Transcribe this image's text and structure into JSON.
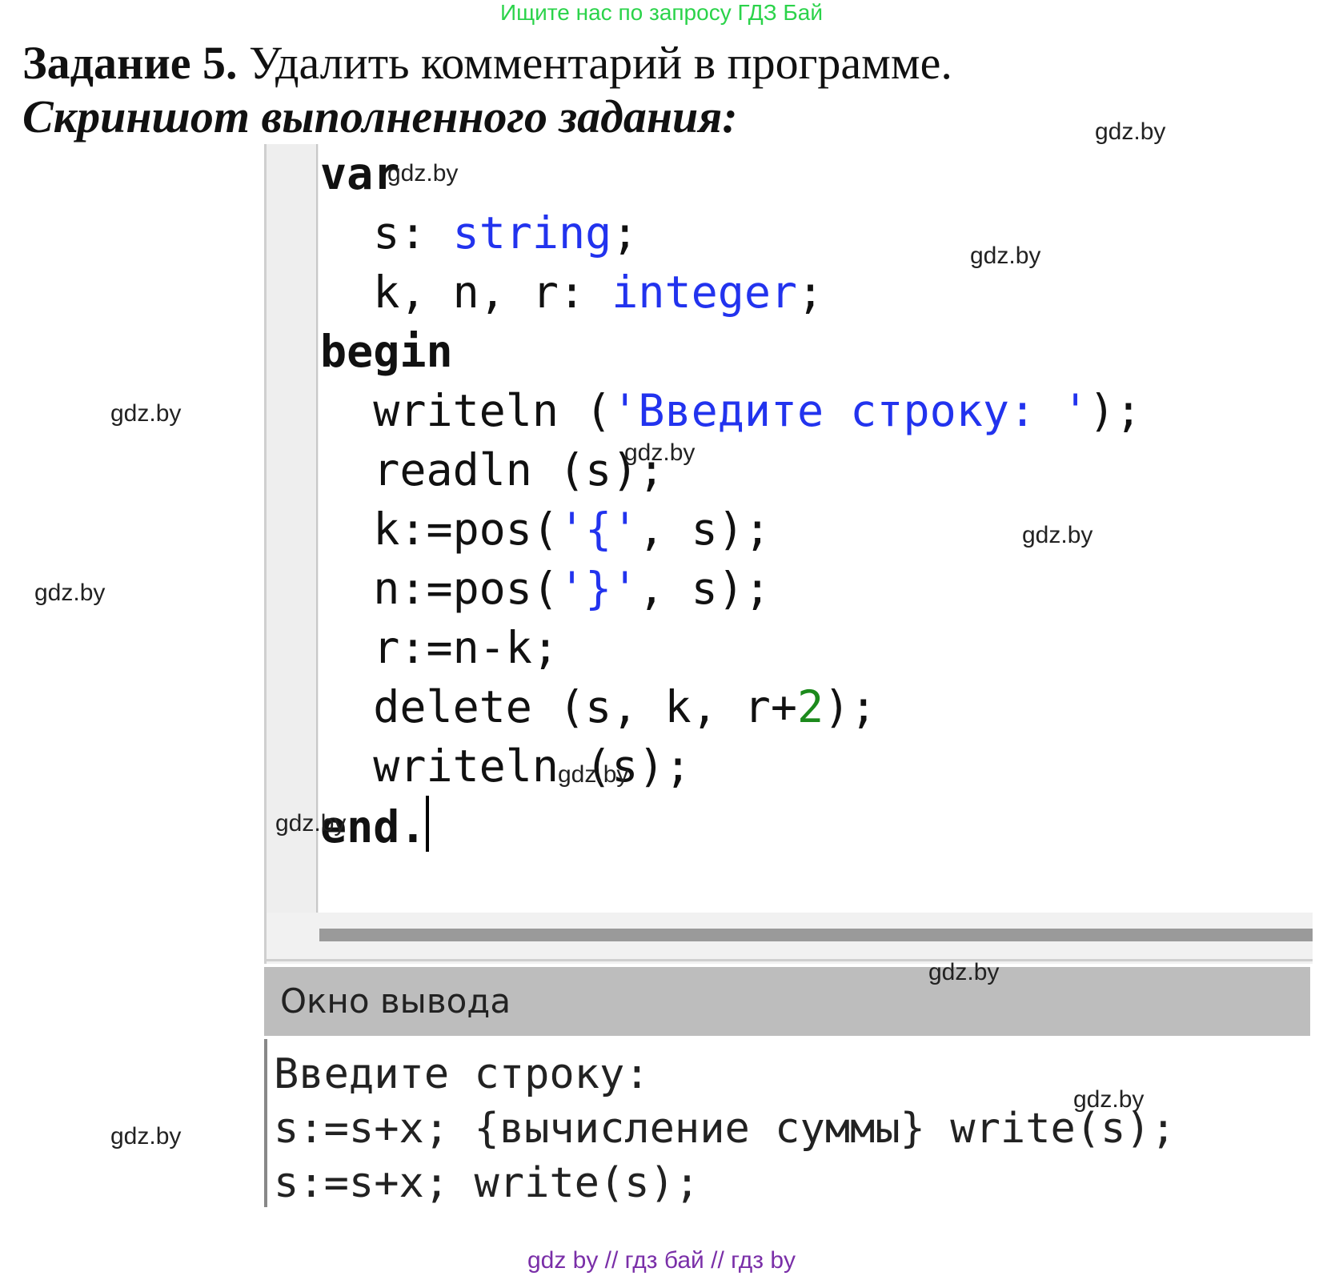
{
  "header_link": "Ищите нас по запросу ГДЗ Бай",
  "task": {
    "label": "Задание 5.",
    "text": " Удалить комментарий в программе."
  },
  "subtitle": "Скриншот выполненного задания:",
  "code_lines": [
    "var",
    "  s: string;",
    "  k, n, r: integer;",
    "begin",
    "  writeln ('Введите строку: ');",
    "  readln (s);",
    "  k:=pos('{', s);",
    "  n:=pos('}', s);",
    "  r:=n-k;",
    "  delete (s, k, r+2);",
    "  writeln (s);",
    "end."
  ],
  "output": {
    "title": "Окно вывода",
    "lines": [
      "Введите строку:",
      "s:=s+x; {вычисление суммы} write(s);",
      "s:=s+x; write(s);"
    ]
  },
  "watermarks": {
    "text": "gdz.by"
  },
  "footer": "gdz by  //  гдз бай  //  гдз by",
  "colors": {
    "keyword_type": "#2233ee",
    "string": "#2233ee",
    "number": "#1c8a1c",
    "header_link": "#2bd34a",
    "footer": "#7a2fa8"
  }
}
